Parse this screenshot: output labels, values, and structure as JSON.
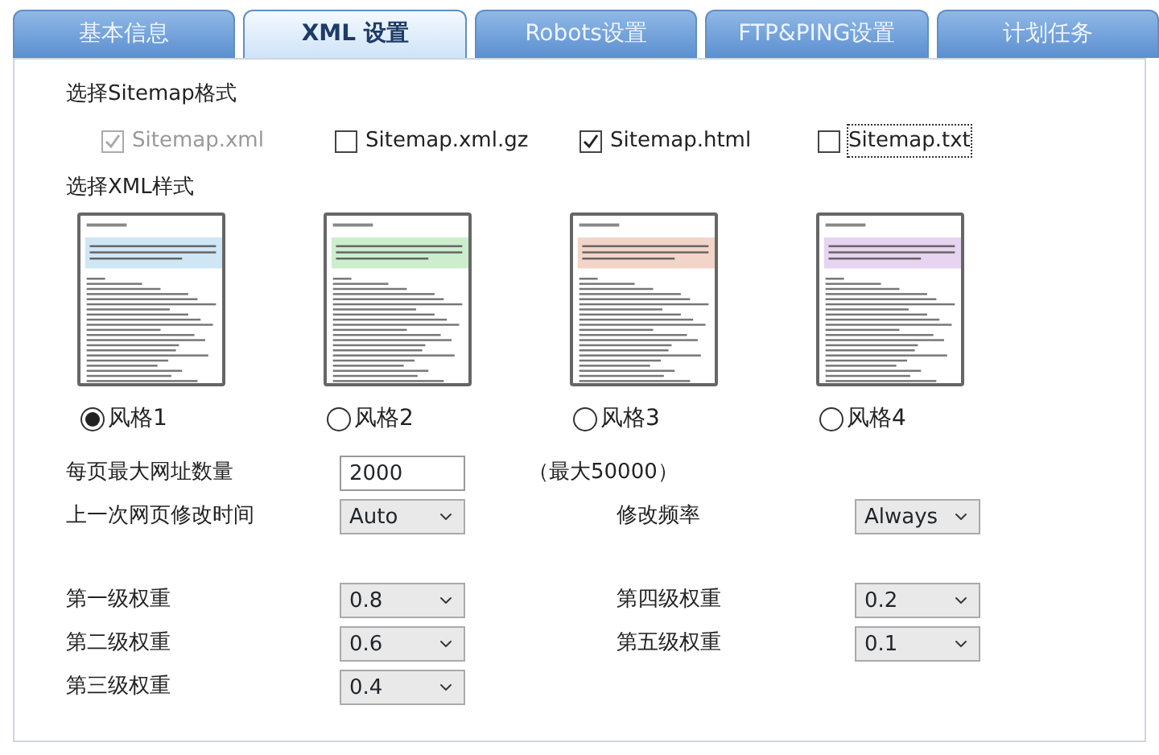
{
  "tabs": [
    {
      "label": "基本信息",
      "selected": false
    },
    {
      "label": "XML 设置",
      "selected": true
    },
    {
      "label": "Robots设置",
      "selected": false
    },
    {
      "label": "FTP&PING设置",
      "selected": false
    },
    {
      "label": "计划任务",
      "selected": false
    }
  ],
  "format": {
    "heading": "选择Sitemap格式",
    "options": [
      {
        "label": "Sitemap.xml",
        "checked": true,
        "disabled": true,
        "focused": false
      },
      {
        "label": "Sitemap.xml.gz",
        "checked": false,
        "disabled": false,
        "focused": false
      },
      {
        "label": "Sitemap.html",
        "checked": true,
        "disabled": false,
        "focused": false
      },
      {
        "label": "Sitemap.txt",
        "checked": false,
        "disabled": false,
        "focused": true
      }
    ]
  },
  "xml_style": {
    "heading": "选择XML样式",
    "styles": [
      {
        "label": "风格1",
        "selected": true,
        "color": "#cfe6f5"
      },
      {
        "label": "风格2",
        "selected": false,
        "color": "#cdeecd"
      },
      {
        "label": "风格3",
        "selected": false,
        "color": "#f2d5c8"
      },
      {
        "label": "风格4",
        "selected": false,
        "color": "#e7d4f0"
      }
    ]
  },
  "settings": {
    "max_urls": {
      "label": "每页最大网址数量",
      "value": "2000",
      "hint": "（最大50000）"
    },
    "lastmod": {
      "label": "上一次网页修改时间",
      "value": "Auto"
    },
    "changefreq": {
      "label": "修改频率",
      "value": "Always"
    },
    "priority_rows": [
      [
        {
          "label": "第一级权重",
          "value": "0.8"
        },
        {
          "label": "第四级权重",
          "value": "0.2"
        }
      ],
      [
        {
          "label": "第二级权重",
          "value": "0.6"
        },
        {
          "label": "第五级权重",
          "value": "0.1"
        }
      ],
      [
        {
          "label": "第三级权重",
          "value": "0.4"
        }
      ]
    ]
  }
}
